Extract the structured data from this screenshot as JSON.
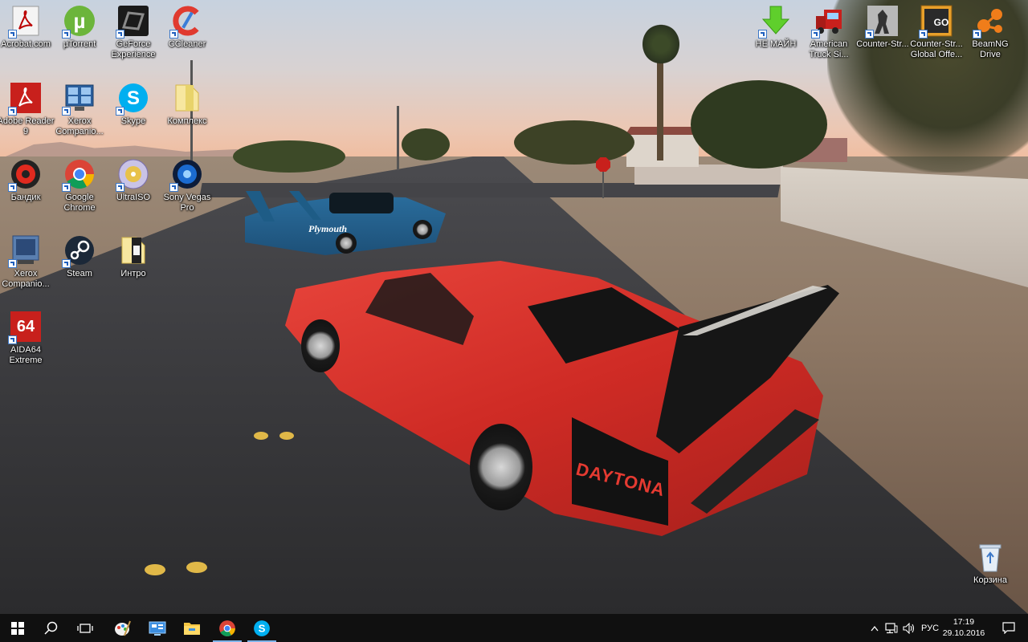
{
  "desktop": {
    "wallpaper": {
      "car_logo_text": "DAYTONA",
      "plymouth_text": "Plymouth"
    },
    "icons_left": [
      {
        "label": "Acrobat.com",
        "icon": "acrobat-icon"
      },
      {
        "label": "µTorrent",
        "icon": "utorrent-icon"
      },
      {
        "label": "GeForce Experience",
        "icon": "geforce-icon"
      },
      {
        "label": "CCleaner",
        "icon": "ccleaner-icon"
      },
      {
        "label": "Adobe Reader 9",
        "icon": "adobe-reader-icon"
      },
      {
        "label": "Xerox Companio...",
        "icon": "xerox-icon"
      },
      {
        "label": "Skype",
        "icon": "skype-icon"
      },
      {
        "label": "Комплекс",
        "icon": "folder-icon"
      },
      {
        "label": "Бандик",
        "icon": "bandicam-icon"
      },
      {
        "label": "Google Chrome",
        "icon": "chrome-icon"
      },
      {
        "label": "UltraISO",
        "icon": "ultraiso-icon"
      },
      {
        "label": "Sony Vegas Pro",
        "icon": "vegas-icon"
      },
      {
        "label": "Xerox Companio...",
        "icon": "xerox-icon"
      },
      {
        "label": "Steam",
        "icon": "steam-icon"
      },
      {
        "label": "Интро",
        "icon": "folder-icon"
      },
      {
        "label": "AIDA64 Extreme",
        "icon": "aida64-icon"
      }
    ],
    "icons_right": [
      {
        "label": "НЕ МАЙН",
        "icon": "download-arrow-icon"
      },
      {
        "label": "American Truck Si...",
        "icon": "truck-icon"
      },
      {
        "label": "Counter-Str...",
        "icon": "counter-strike-icon"
      },
      {
        "label": "Counter-Str... Global Offe...",
        "icon": "csgo-icon"
      },
      {
        "label": "BeamNG Drive",
        "icon": "beamng-icon"
      }
    ],
    "recycle_bin": {
      "label": "Корзина",
      "icon": "recycle-bin-icon"
    }
  },
  "taskbar": {
    "pinned": [
      {
        "name": "start",
        "icon": "windows-logo-icon"
      },
      {
        "name": "search",
        "icon": "search-icon"
      },
      {
        "name": "task-view",
        "icon": "task-view-icon"
      },
      {
        "name": "paint",
        "icon": "paint-icon"
      },
      {
        "name": "control-panel",
        "icon": "control-panel-icon"
      },
      {
        "name": "file-explorer",
        "icon": "file-explorer-icon"
      },
      {
        "name": "chrome",
        "icon": "chrome-icon"
      },
      {
        "name": "skype",
        "icon": "skype-icon"
      }
    ],
    "tray": {
      "language": "РУС",
      "time": "17:19",
      "date": "29.10.2016"
    }
  },
  "colors": {
    "taskbar_bg": "#101010",
    "active_indicator": "#7eb4ea",
    "chrome_red": "#db4437",
    "chrome_green": "#0f9d58",
    "chrome_yellow": "#f4b400",
    "chrome_blue": "#4285f4",
    "skype_blue": "#00aff0",
    "steam_blue": "#1b2838"
  }
}
